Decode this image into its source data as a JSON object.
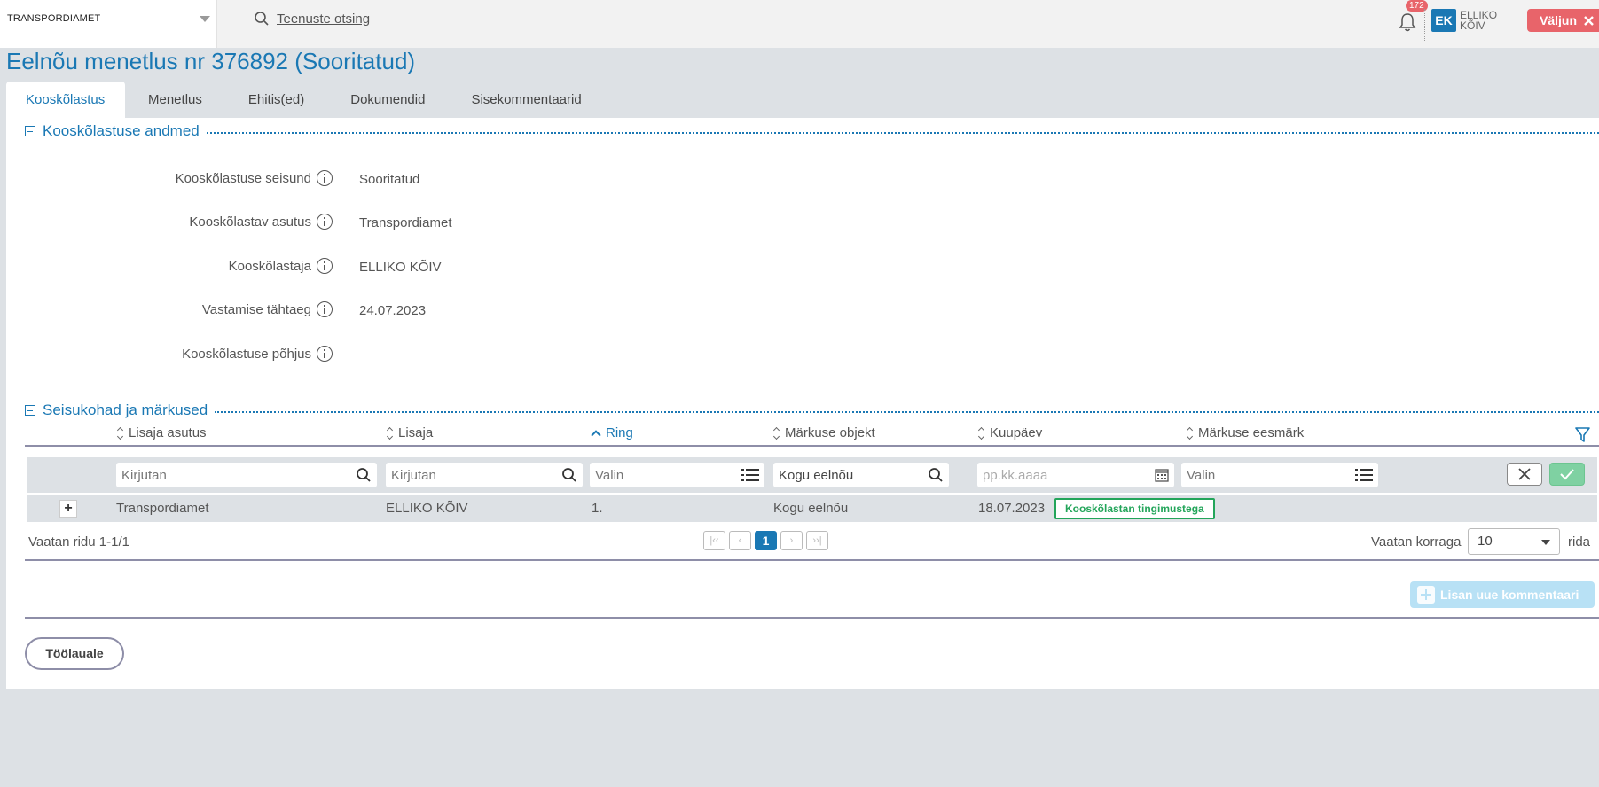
{
  "header": {
    "org_name": "TRANSPORDIAMET",
    "search_label": "Teenuste otsing",
    "notification_count": "172",
    "user_initials": "EK",
    "user_first": "ELLIKO",
    "user_last": "KÕIV",
    "logout_label": "Väljun"
  },
  "page": {
    "title": "Eelnõu menetlus nr 376892 (Sooritatud)"
  },
  "tabs": [
    {
      "label": "Kooskõlastus",
      "active": true
    },
    {
      "label": "Menetlus"
    },
    {
      "label": "Ehitis(ed)"
    },
    {
      "label": "Dokumendid"
    },
    {
      "label": "Sisekommentaarid"
    }
  ],
  "section1": {
    "title": "Kooskõlastuse andmed",
    "fields": [
      {
        "label": "Kooskõlastuse seisund",
        "value": "Sooritatud"
      },
      {
        "label": "Kooskõlastav asutus",
        "value": "Transpordiamet"
      },
      {
        "label": "Kooskõlastaja",
        "value": "ELLIKO KÕIV"
      },
      {
        "label": "Vastamise tähtaeg",
        "value": "24.07.2023"
      },
      {
        "label": "Kooskõlastuse põhjus",
        "value": ""
      }
    ]
  },
  "section2": {
    "title": "Seisukohad ja märkused",
    "columns": [
      "Lisaja asutus",
      "Lisaja",
      "Ring",
      "Märkuse objekt",
      "Kuupäev",
      "Märkuse eesmärk"
    ],
    "filters": {
      "lisaja_asutus": "Kirjutan",
      "lisaja": "Kirjutan",
      "ring": "Valin",
      "markuse_objekt": "Kogu eelnõu",
      "kuupaev": "pp.kk.aaaa",
      "eesmark": "Valin"
    },
    "rows": [
      {
        "lisaja_asutus": "Transpordiamet",
        "lisaja": "ELLIKO KÕIV",
        "ring": "1.",
        "markuse_objekt": "Kogu eelnõu",
        "kuupaev": "18.07.2023",
        "eesmark": "Kooskõlastan tingimustega"
      }
    ],
    "pager_info": "Vaatan ridu 1-1/1",
    "current_page": "1",
    "per_page_label": "Vaatan korraga",
    "per_page_value": "10",
    "rows_suffix": "rida",
    "add_comment_label": "Lisan uue kommentaari"
  },
  "footer": {
    "worktable_label": "Töölauale"
  },
  "colors": {
    "accent": "#1a78b4",
    "danger": "#e8646a",
    "success": "#23a55a"
  }
}
